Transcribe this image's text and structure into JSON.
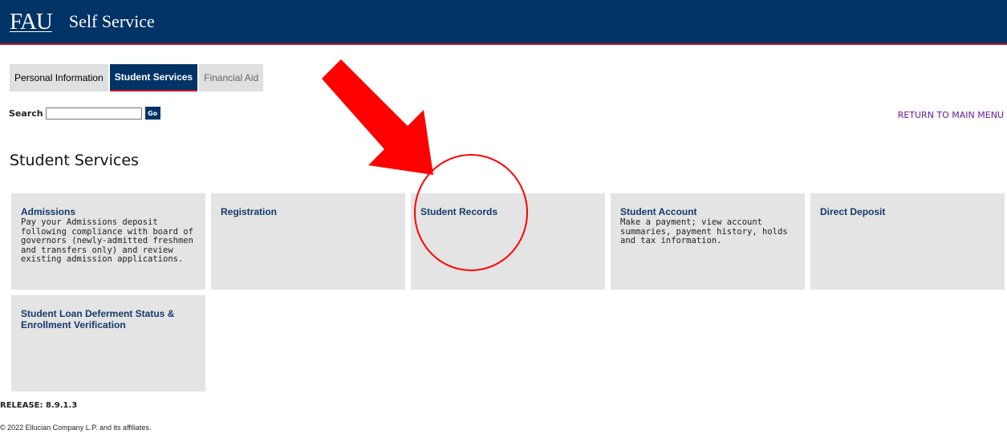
{
  "header": {
    "logo": "FAU",
    "title": "Self Service"
  },
  "tabs": [
    {
      "label": "Personal Information",
      "state": "normal"
    },
    {
      "label": "Student Services",
      "state": "active"
    },
    {
      "label": "Financial Aid",
      "state": "disabled"
    }
  ],
  "search": {
    "label": "Search",
    "value": "",
    "button_label": "Go"
  },
  "return_link": "RETURN TO MAIN MENU",
  "page_title": "Student Services",
  "cards": [
    {
      "title": "Admissions",
      "description": "Pay your Admissions deposit following compliance with board of governors (newly-admitted freshmen and transfers only) and review existing admission applications."
    },
    {
      "title": "Registration",
      "description": ""
    },
    {
      "title": "Student Records",
      "description": ""
    },
    {
      "title": "Student Account",
      "description": "Make a payment; view account summaries, payment history, holds and tax information."
    },
    {
      "title": "Direct Deposit",
      "description": ""
    },
    {
      "title": "Student Loan Deferment Status & Enrollment Verification",
      "description": ""
    }
  ],
  "footer": {
    "release": "RELEASE: 8.9.1.3",
    "copyright": "© 2022 Ellucian Company L.P. and its affiliates."
  },
  "colors": {
    "header_bg": "#003366",
    "accent_red": "#c8102e",
    "annotation_red": "#ff0000",
    "card_bg": "#e4e4e4",
    "link_purple": "#6a1b9a"
  },
  "annotations": {
    "arrow": "red-arrow-icon",
    "highlight": "red-circle-highlight"
  }
}
